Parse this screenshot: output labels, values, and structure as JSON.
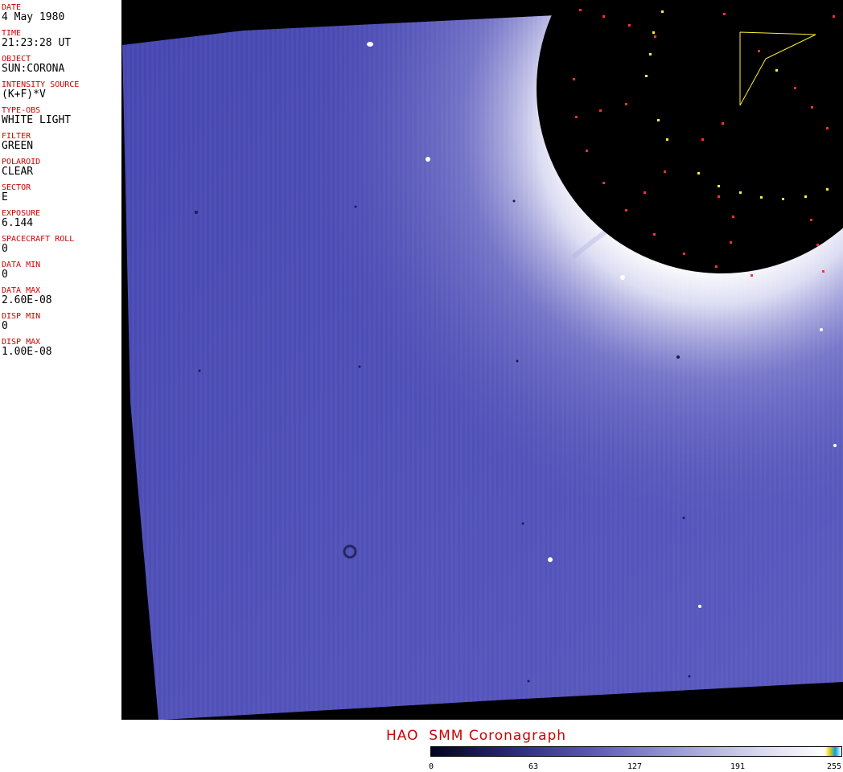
{
  "metadata": [
    {
      "label": "DATE",
      "value": "4 May 1980"
    },
    {
      "label": "TIME",
      "value": "21:23:28 UT"
    },
    {
      "label": "OBJECT",
      "value": "SUN:CORONA"
    },
    {
      "label": "INTENSITY SOURCE",
      "value": "(K+F)*V"
    },
    {
      "label": "TYPE-OBS",
      "value": "WHITE LIGHT"
    },
    {
      "label": "FILTER",
      "value": "GREEN"
    },
    {
      "label": "POLAROID",
      "value": "CLEAR"
    },
    {
      "label": "SECTOR",
      "value": "E"
    },
    {
      "label": "EXPOSURE",
      "value": "6.144"
    },
    {
      "label": "SPACECRAFT ROLL",
      "value": "0"
    },
    {
      "label": "DATA MIN",
      "value": "0"
    },
    {
      "label": "DATA MAX",
      "value": "2.60E-08"
    },
    {
      "label": "DISP MIN",
      "value": "0"
    },
    {
      "label": "DISP MAX",
      "value": "1.00E-08"
    }
  ],
  "footer": {
    "title": "HAO  SMM Coronagraph",
    "colorbar_ticks": [
      "0",
      "63",
      "127",
      "191",
      "255"
    ]
  },
  "colors": {
    "label": "#cc0000",
    "corona": "#4a4ab4",
    "background": "#000000"
  }
}
